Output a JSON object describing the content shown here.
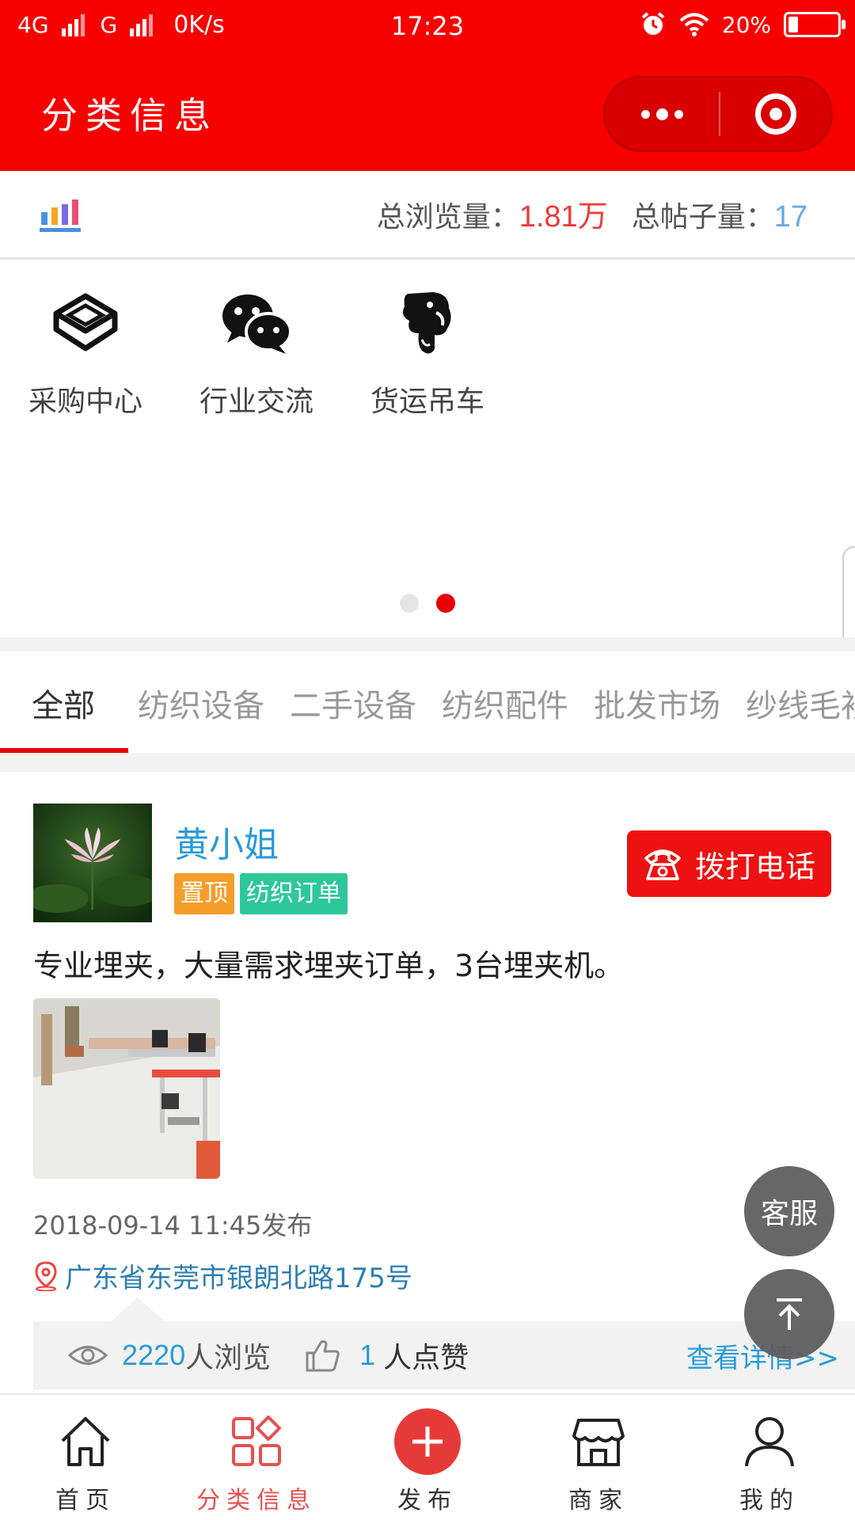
{
  "status_bar": {
    "network1": "4G",
    "network2": "G",
    "speed": "0K/s",
    "time": "17:23",
    "battery": "20%",
    "battery_level": 0.2
  },
  "nav": {
    "title": "分类信息",
    "brand_color": "#f70000"
  },
  "stats": {
    "views_label": "总浏览量：",
    "views_value": "1.81万",
    "posts_label": "总帖子量：",
    "posts_value": "17"
  },
  "categories": [
    {
      "label": "采购中心",
      "icon": "box-icon"
    },
    {
      "label": "行业交流",
      "icon": "wechat-icon"
    },
    {
      "label": "货运吊车",
      "icon": "elephant-icon"
    }
  ],
  "carousel": {
    "pages": 2,
    "active": 2
  },
  "tabs": [
    "全部",
    "纺织设备",
    "二手设备",
    "纺织配件",
    "批发市场",
    "纱线毛衫"
  ],
  "post": {
    "user_name": "黄小姐",
    "badge_top": "置顶",
    "badge_category": "纺织订单",
    "call_label": "拨打电话",
    "text": "专业埋夹，大量需求埋夹订单，3台埋夹机。",
    "time": "2018-09-14 11:45发布",
    "location": "广东省东莞市银朗北路175号",
    "views": "2220",
    "views_suffix": "人浏览",
    "likes": "1",
    "likes_suffix": "人点赞",
    "detail_link": "查看详情>>"
  },
  "floating": {
    "service_label": "客服",
    "to_top_icon": "arrow-up-icon"
  },
  "tabbar": [
    {
      "label": "首页",
      "icon": "home-icon",
      "active": false
    },
    {
      "label": "分类信息",
      "icon": "grid-icon",
      "active": true
    },
    {
      "label": "发布",
      "icon": "plus-icon",
      "active": false
    },
    {
      "label": "商家",
      "icon": "shop-icon",
      "active": false
    },
    {
      "label": "我的",
      "icon": "user-icon",
      "active": false
    }
  ]
}
